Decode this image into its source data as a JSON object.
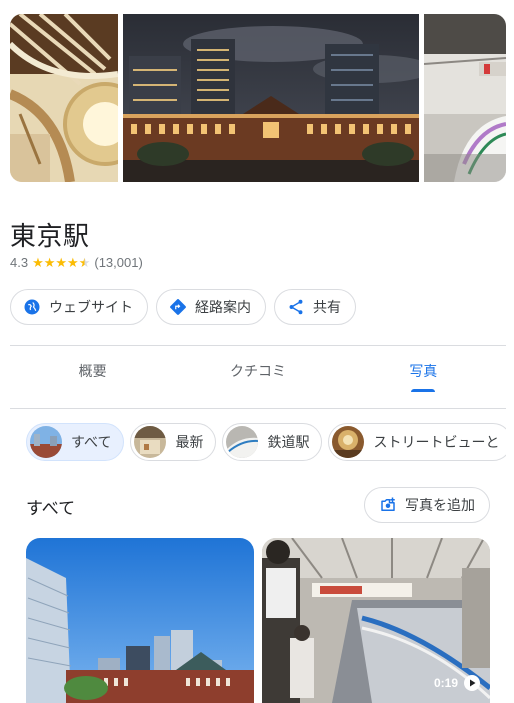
{
  "place": {
    "name": "東京駅",
    "rating": "4.3",
    "review_count": "(13,001)"
  },
  "actions": {
    "website": "ウェブサイト",
    "directions": "経路案内",
    "share": "共有"
  },
  "tabs": [
    {
      "label": "概要",
      "active": false
    },
    {
      "label": "クチコミ",
      "active": false
    },
    {
      "label": "写真",
      "active": true
    }
  ],
  "chips": [
    {
      "label": "すべて",
      "selected": true
    },
    {
      "label": "最新",
      "selected": false
    },
    {
      "label": "鉄道駅",
      "selected": false
    },
    {
      "label": "ストリートビューと",
      "selected": false
    }
  ],
  "photos_section": {
    "title": "すべて",
    "add_photo": "写真を追加",
    "video_duration": "0:19"
  },
  "colors": {
    "accent": "#1a73e8",
    "star": "#fbbc04",
    "chip_selected_bg": "#e8f0fe"
  },
  "icons": [
    "globe-icon",
    "directions-icon",
    "share-icon",
    "add-photo-icon",
    "play-icon"
  ]
}
